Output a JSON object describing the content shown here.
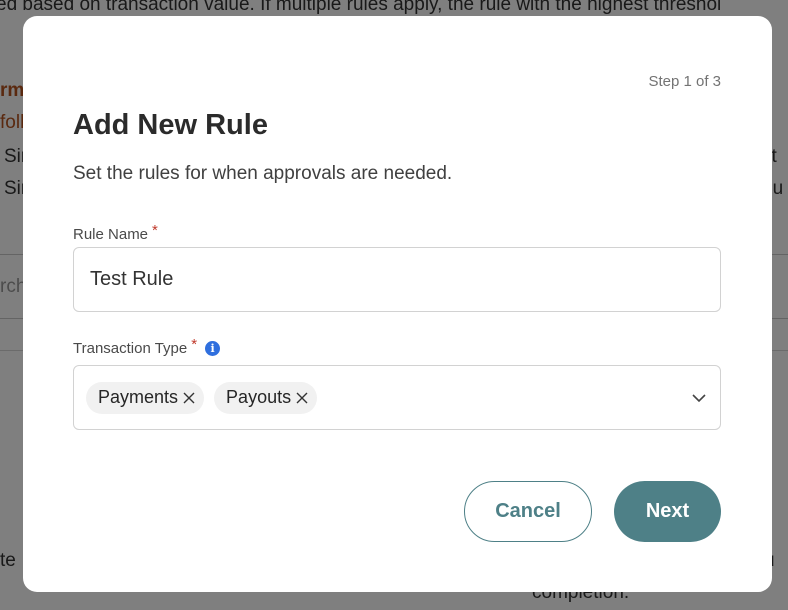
{
  "background": {
    "intro_text": "ed based on transaction value. If multiple rules apply, the rule with the highest threshol",
    "heading_fragment": "rm",
    "sub_fragment": "foll",
    "list_item_1_fragment": "Sir",
    "list_item_2_fragment": "Sir",
    "right_fragment_1": "st",
    "right_fragment_2": "ou",
    "search_fragment": "rch",
    "left_bottom_fragment": "te",
    "right_bottom_fragment": "u",
    "completion_text": "completion."
  },
  "modal": {
    "step": "Step 1 of 3",
    "title": "Add New Rule",
    "subtitle": "Set the rules for when approvals are needed.",
    "rule_name": {
      "label": "Rule Name",
      "required_mark": "*",
      "value": "Test Rule"
    },
    "transaction_type": {
      "label": "Transaction Type",
      "required_mark": "*",
      "info_icon": "info-icon",
      "info_glyph": "i",
      "selected": [
        "Payments",
        "Payouts"
      ]
    },
    "buttons": {
      "cancel": "Cancel",
      "next": "Next"
    }
  },
  "colors": {
    "accent": "#4e8087",
    "required": "#c0392b",
    "info": "#2f6fde",
    "overlay": "rgba(0,0,0,0.5)"
  }
}
